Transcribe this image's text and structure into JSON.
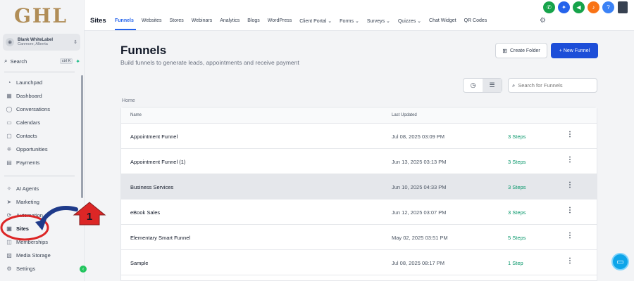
{
  "brand": {
    "logo_text": "GHL"
  },
  "account": {
    "name": "Blank WhiteLabel",
    "location": "Canmore, Alberta"
  },
  "sidebar_search": {
    "label": "Search",
    "shortcut": "ctrl K"
  },
  "sidebar": {
    "items": [
      {
        "label": "Launchpad",
        "icon": "rocket-icon",
        "glyph": "◔"
      },
      {
        "label": "Dashboard",
        "icon": "dashboard-icon",
        "glyph": "▦"
      },
      {
        "label": "Conversations",
        "icon": "chat-bubble-icon",
        "glyph": "◯"
      },
      {
        "label": "Calendars",
        "icon": "calendar-icon",
        "glyph": "▭"
      },
      {
        "label": "Contacts",
        "icon": "contacts-icon",
        "glyph": "▢"
      },
      {
        "label": "Opportunities",
        "icon": "opportunities-icon",
        "glyph": "⁜"
      },
      {
        "label": "Payments",
        "icon": "payments-icon",
        "glyph": "▤"
      },
      {
        "label": "AI Agents",
        "icon": "sparkle-icon",
        "glyph": "✧"
      },
      {
        "label": "Marketing",
        "icon": "send-icon",
        "glyph": "➤"
      },
      {
        "label": "Automation",
        "icon": "automation-icon",
        "glyph": "⟳"
      },
      {
        "label": "Sites",
        "icon": "sites-icon",
        "glyph": "▣"
      },
      {
        "label": "Memberships",
        "icon": "memberships-icon",
        "glyph": "◫"
      },
      {
        "label": "Media Storage",
        "icon": "media-storage-icon",
        "glyph": "▧"
      },
      {
        "label": "Settings",
        "icon": "gear-icon",
        "glyph": "⚙"
      }
    ]
  },
  "topbar": {
    "title": "Sites",
    "tabs": [
      {
        "label": "Funnels"
      },
      {
        "label": "Websites"
      },
      {
        "label": "Stores"
      },
      {
        "label": "Webinars"
      },
      {
        "label": "Analytics"
      },
      {
        "label": "Blogs"
      },
      {
        "label": "WordPress"
      },
      {
        "label": "Client Portal ⌄"
      },
      {
        "label": "Forms ⌄"
      },
      {
        "label": "Surveys ⌄"
      },
      {
        "label": "Quizzes ⌄"
      },
      {
        "label": "Chat Widget"
      },
      {
        "label": "QR Codes"
      }
    ],
    "icon_colors": [
      "#16a34a",
      "#2563eb",
      "#16a34a",
      "#f97316",
      "#3b82f6"
    ]
  },
  "main": {
    "title": "Funnels",
    "subtitle": "Build funnels to generate leads, appointments and receive payment",
    "create_folder_label": "Create Folder",
    "new_funnel_label": "+  New Funnel",
    "search_placeholder": "Search for Funnels",
    "breadcrumb": "Home"
  },
  "table": {
    "columns": {
      "name": "Name",
      "updated": "Last Updated"
    },
    "rows": [
      {
        "name": "Appointment Funnel",
        "updated": "Jul 08, 2025 03:09 PM",
        "steps": "3 Steps"
      },
      {
        "name": "Appointment Funnel (1)",
        "updated": "Jun 13, 2025 03:13 PM",
        "steps": "3 Steps"
      },
      {
        "name": "Business Services",
        "updated": "Jun 10, 2025 04:33 PM",
        "steps": "3 Steps"
      },
      {
        "name": "eBook Sales",
        "updated": "Jun 12, 2025 03:07 PM",
        "steps": "3 Steps"
      },
      {
        "name": "Elementary Smart Funnel",
        "updated": "May 02, 2025 03:51 PM",
        "steps": "5 Steps"
      },
      {
        "name": "Sample",
        "updated": "Jul 08, 2025 08:17 PM",
        "steps": "1 Step"
      }
    ]
  },
  "annotation": {
    "step_number": "1",
    "color": "#dc2626",
    "arrow_color": "#1e3a8a"
  }
}
